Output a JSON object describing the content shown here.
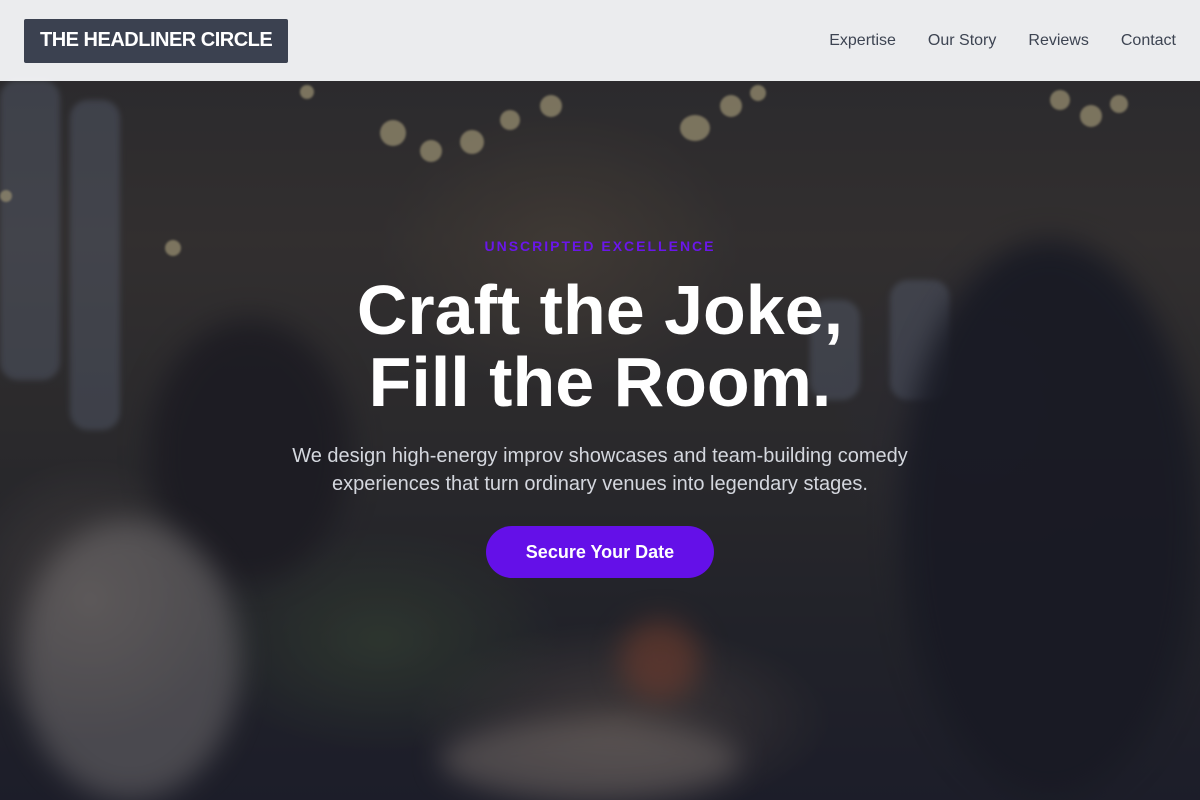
{
  "header": {
    "brand": "THE HEADLINER CIRCLE",
    "nav": [
      {
        "label": "Expertise"
      },
      {
        "label": "Our Story"
      },
      {
        "label": "Reviews"
      },
      {
        "label": "Contact"
      }
    ]
  },
  "hero": {
    "eyebrow": "UNSCRIPTED EXCELLENCE",
    "headline_line1": "Craft the Joke,",
    "headline_line2": "Fill the Room.",
    "subtext_line1": "We design high-energy improv showcases and team-building comedy",
    "subtext_line2": "experiences that turn ordinary venues into legendary stages.",
    "cta_label": "Secure Your Date"
  },
  "colors": {
    "accent": "#6410e8",
    "eyebrow": "#6a16ea",
    "brand_bg": "#3b4150",
    "header_bg": "#f4f5f7"
  }
}
